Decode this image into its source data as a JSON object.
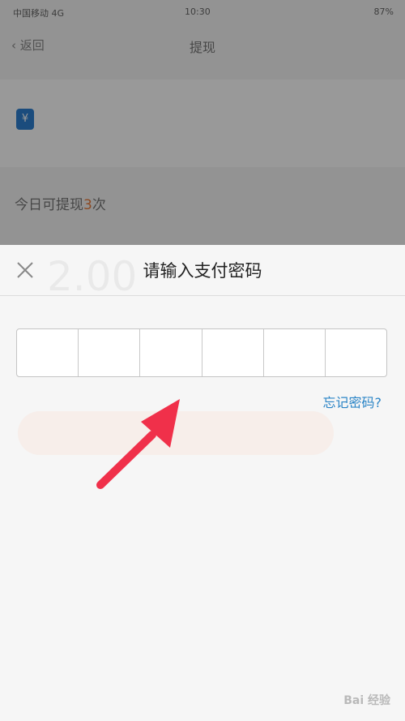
{
  "background": {
    "status_bar": {
      "carrier": "中国移动 4G",
      "time": "10:30",
      "battery": "87%"
    },
    "nav": {
      "back_label": "返回",
      "title": "提现"
    },
    "withdraw_limit": {
      "prefix": "今日可提现",
      "count": "3",
      "suffix": "次"
    },
    "ghost_amount": "2.00"
  },
  "dialog": {
    "title": "请输入支付密码",
    "close_icon": "close-icon",
    "password_cells": [
      "",
      "",
      "",
      "",
      "",
      ""
    ],
    "forgot_link": "忘记密码?"
  },
  "overlay": {
    "arrow_color": "#f0304a"
  },
  "watermark": "Bai 经验",
  "colors": {
    "link": "#2a84c6",
    "highlight": "#e87b3b",
    "bank_icon": "#2e7fd0"
  }
}
